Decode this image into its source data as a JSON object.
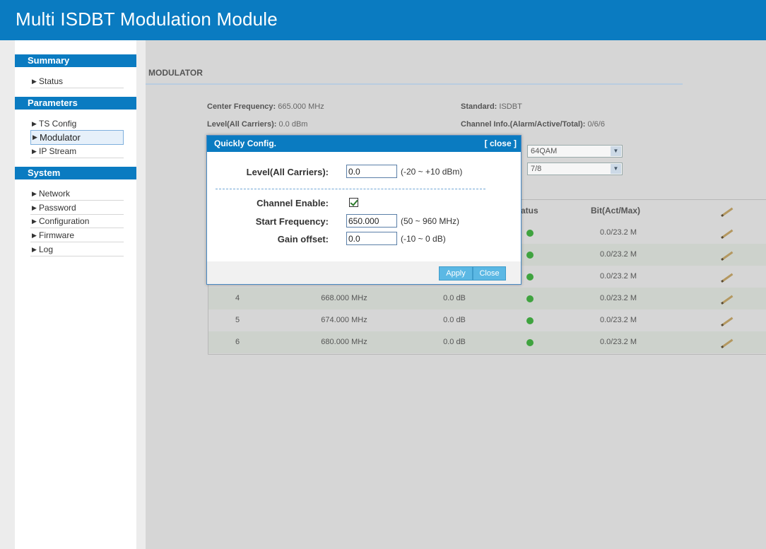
{
  "header": {
    "title": "Multi ISDBT Modulation Module"
  },
  "sidebar": {
    "summary": {
      "heading": "Summary",
      "items": [
        "Status"
      ]
    },
    "parameters": {
      "heading": "Parameters",
      "items": [
        "TS Config",
        "Modulator",
        "IP Stream"
      ]
    },
    "system": {
      "heading": "System",
      "items": [
        "Network",
        "Password",
        "Configuration",
        "Firmware",
        "Log"
      ]
    }
  },
  "main": {
    "title": "MODULATOR",
    "info": {
      "center_freq_label": "Center Frequency:",
      "center_freq_value": "665.000 MHz",
      "standard_label": "Standard:",
      "standard_value": "ISDBT",
      "level_label": "Level(All Carriers):",
      "level_value": "0.0 dBm",
      "channel_info_label": "Channel Info.(Alarm/Active/Total):",
      "channel_info_value": "0/6/6"
    },
    "selects": {
      "constellation": "64QAM",
      "code_rate": "7/8"
    },
    "table": {
      "headers": {
        "status": "tatus",
        "bit": "Bit(Act/Max)"
      },
      "rows": [
        {
          "no": "",
          "freq": "",
          "gain": "",
          "bit": "0.0/23.2 M"
        },
        {
          "no": "",
          "freq": "",
          "gain": "",
          "bit": "0.0/23.2 M"
        },
        {
          "no": "",
          "freq": "",
          "gain": "",
          "bit": "0.0/23.2 M"
        },
        {
          "no": "4",
          "freq": "668.000 MHz",
          "gain": "0.0 dB",
          "bit": "0.0/23.2 M"
        },
        {
          "no": "5",
          "freq": "674.000 MHz",
          "gain": "0.0 dB",
          "bit": "0.0/23.2 M"
        },
        {
          "no": "6",
          "freq": "680.000 MHz",
          "gain": "0.0 dB",
          "bit": "0.0/23.2 M"
        }
      ]
    }
  },
  "modal": {
    "title": "Quickly Config.",
    "close_link": "[ close ]",
    "level_label": "Level(All Carriers):",
    "level_value": "0.0",
    "level_range": "(-20 ~ +10 dBm)",
    "channel_enable_label": "Channel Enable:",
    "start_freq_label": "Start Frequency:",
    "start_freq_value": "650.000",
    "start_freq_range": "(50 ~ 960 MHz)",
    "gain_label": "Gain offset:",
    "gain_value": "0.0",
    "gain_range": "(-10 ~ 0 dB)",
    "apply_label": "Apply",
    "close_label": "Close"
  },
  "colors": {
    "brand": "#0a7bc1",
    "status_ok": "#3fa33f",
    "button": "#5bb8e4"
  }
}
